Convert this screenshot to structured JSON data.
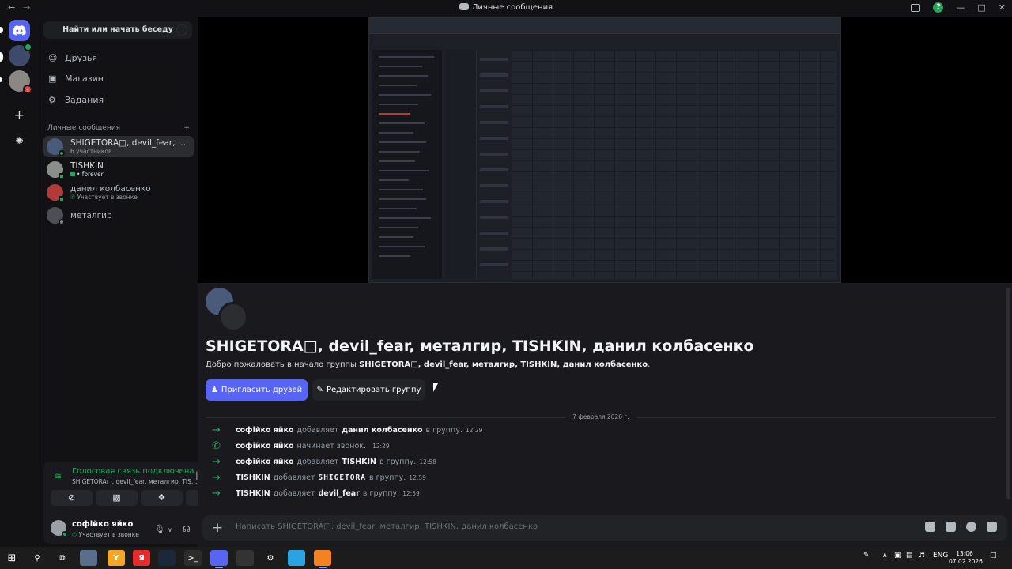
{
  "window": {
    "title": "Личные сообщения"
  },
  "sidebar": {
    "search": "Найти или начать беседу",
    "nav": [
      {
        "label": "Друзья"
      },
      {
        "label": "Магазин"
      },
      {
        "label": "Задания"
      }
    ],
    "dm_header": "Личные сообщения",
    "dms": [
      {
        "name": "SHIGETORA□, devil_fear, метал…",
        "sub": "6 участников",
        "status": "online"
      },
      {
        "name": "TISHKIN",
        "sub": "• forever",
        "status": "mobile"
      },
      {
        "name": "данил колбасенко",
        "sub": "Участвует в звонке",
        "status": "mobile"
      },
      {
        "name": "металгир",
        "sub": "",
        "status": "offline"
      }
    ]
  },
  "guilds": {
    "badge": "1"
  },
  "voice": {
    "title": "Голосовая связь подключена",
    "sub": "SHIGETORA□, devil_fear, металгир, TIS…"
  },
  "user": {
    "name": "софійко яйко",
    "sub": "Участвует в звонке"
  },
  "channel": {
    "title": "SHIGETORA□, devil_fear, металгир, TISHKIN, данил колбасенко",
    "welcome_prefix": "Добро пожаловать в начало группы ",
    "welcome_group": "SHIGETORA□, devil_fear, металгир, TISHKIN, данил колбасенко",
    "welcome_suffix": ".",
    "invite_label": "Пригласить друзей",
    "edit_label": "Редактировать группу",
    "date": "7 февраля 2026 г."
  },
  "messages": [
    {
      "actor": "софійко яйко",
      "action": "добавляет",
      "target": "данил колбасенко",
      "tail": "в группу.",
      "time": "12:29",
      "icon": "arrow"
    },
    {
      "actor": "софійко яйко",
      "action": "начинает звонок.",
      "target": "",
      "tail": "",
      "time": "12:29",
      "icon": "phone"
    },
    {
      "actor": "софійко яйко",
      "action": "добавляет",
      "target": "TISHKIN",
      "tail": "в группу.",
      "time": "12:58",
      "icon": "arrow"
    },
    {
      "actor": "TISHKIN",
      "action": "добавляет",
      "target": "SHIGETORA",
      "tail": "в группу.",
      "time": "12:59",
      "icon": "arrow"
    },
    {
      "actor": "TISHKIN",
      "action": "добавляет",
      "target": "devil_fear",
      "tail": "в группу.",
      "time": "12:59",
      "icon": "arrow"
    }
  ],
  "composer": {
    "placeholder": "Написать SHIGETORA□, devil_fear, металгир, TISHKIN, данил колбасенко"
  },
  "taskbar": {
    "lang": "ENG",
    "time": "13:06",
    "date": "07.02.2026"
  },
  "colors": {
    "accent": "#5865f2",
    "green": "#23a55a",
    "red": "#f23f43"
  }
}
